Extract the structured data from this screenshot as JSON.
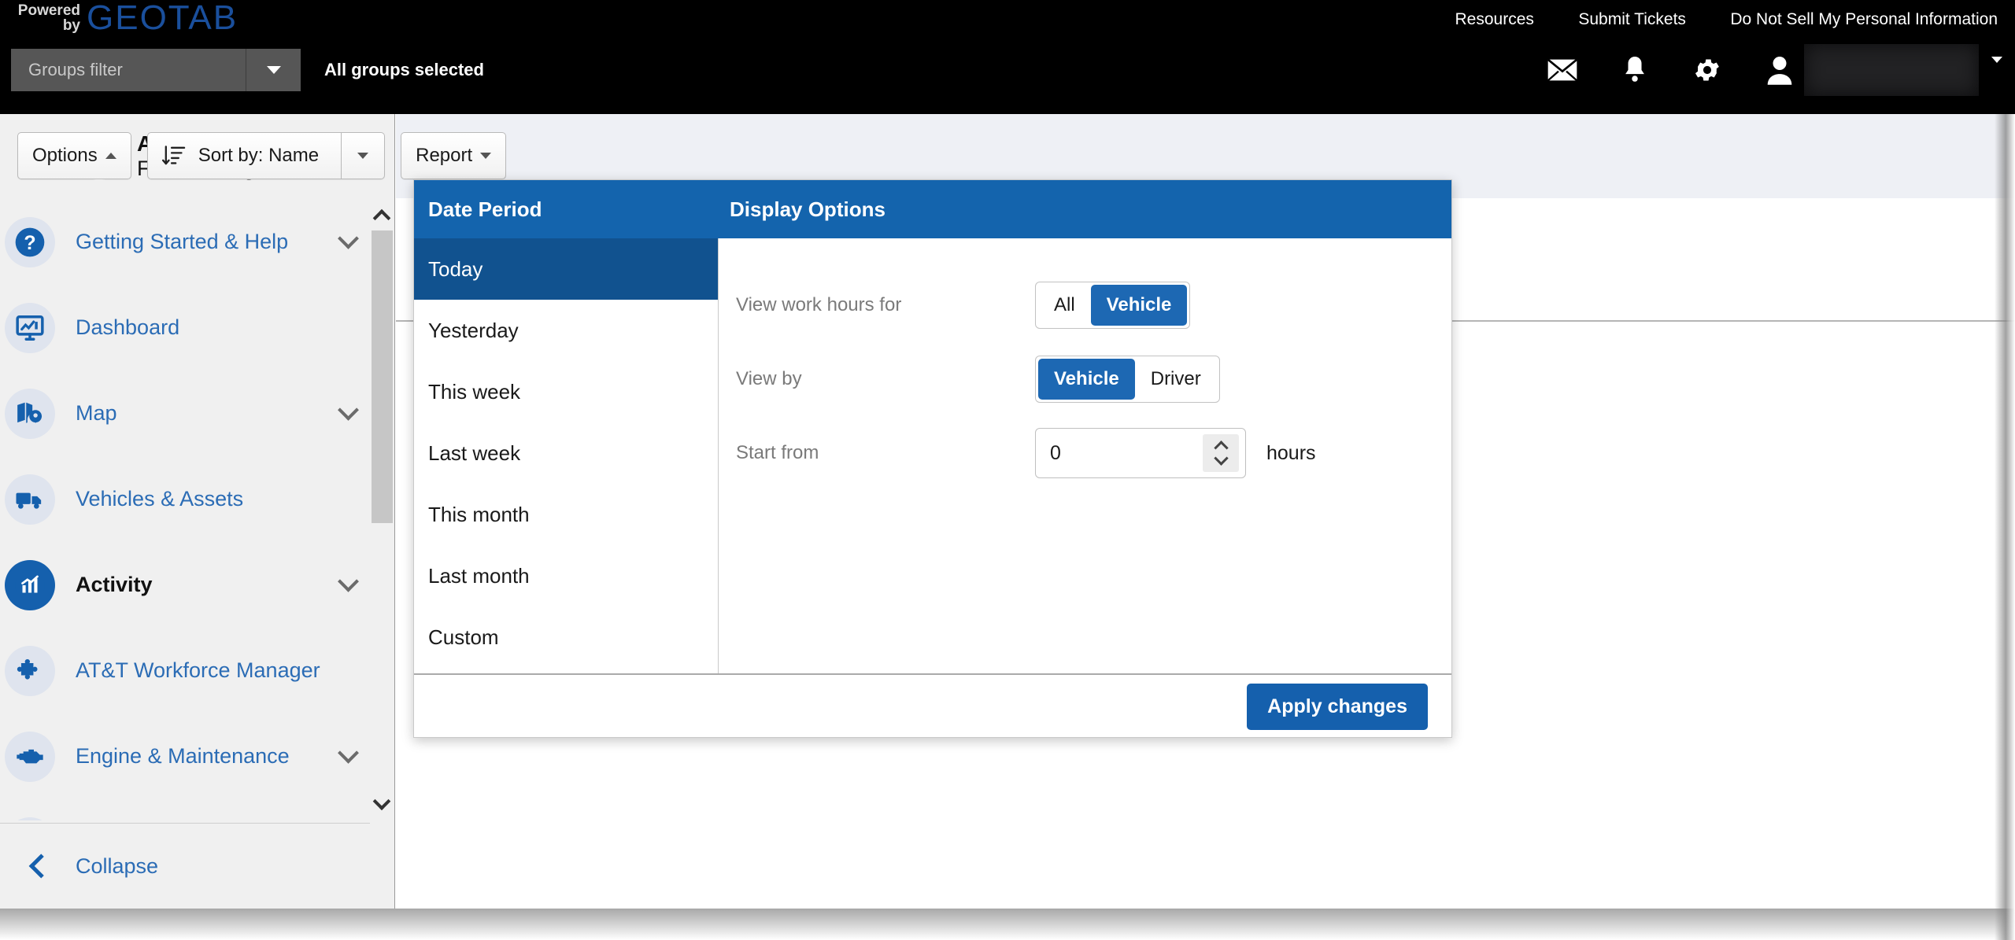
{
  "header": {
    "powered_line1": "Powered",
    "powered_line2": "by",
    "brand": "GEOTAB",
    "links": [
      {
        "label": "Resources"
      },
      {
        "label": "Submit Tickets"
      },
      {
        "label": "Do Not Sell My Personal Information"
      }
    ],
    "groups_filter_placeholder": "Groups filter",
    "groups_filter_value": "",
    "groups_selected_text": "All groups selected",
    "icons": [
      {
        "name": "mail-icon"
      },
      {
        "name": "bell-icon"
      },
      {
        "name": "gear-icon"
      },
      {
        "name": "user-icon"
      }
    ],
    "user_name": ""
  },
  "sidebar": {
    "search_icon": "search-icon",
    "product_line1": "AT&T",
    "product_line2": "Fleet Management",
    "items": [
      {
        "label": "Getting Started & Help",
        "icon": "help-circle-icon",
        "chevron": true,
        "active": false
      },
      {
        "label": "Dashboard",
        "icon": "dashboard-icon",
        "chevron": false,
        "active": false
      },
      {
        "label": "Map",
        "icon": "map-pin-icon",
        "chevron": true,
        "active": false
      },
      {
        "label": "Vehicles & Assets",
        "icon": "truck-icon",
        "chevron": false,
        "active": false
      },
      {
        "label": "Activity",
        "icon": "activity-chart-icon",
        "chevron": true,
        "active": true
      },
      {
        "label": "AT&T Workforce Manager",
        "icon": "puzzle-icon",
        "chevron": false,
        "active": false
      },
      {
        "label": "Engine & Maintenance",
        "icon": "engine-icon",
        "chevron": true,
        "active": false
      }
    ],
    "collapse_label": "Collapse"
  },
  "toolbar": {
    "options_label": "Options",
    "sort_label": "Sort by:  Name",
    "report_label": "Report"
  },
  "panel": {
    "date_period_title": "Date Period",
    "display_options_title": "Display Options",
    "date_periods": [
      {
        "label": "Today",
        "selected": true
      },
      {
        "label": "Yesterday",
        "selected": false
      },
      {
        "label": "This week",
        "selected": false
      },
      {
        "label": "Last week",
        "selected": false
      },
      {
        "label": "This month",
        "selected": false
      },
      {
        "label": "Last month",
        "selected": false
      },
      {
        "label": "Custom",
        "selected": false
      }
    ],
    "view_work_hours_for": {
      "label": "View work hours for",
      "options": [
        {
          "label": "All",
          "selected": false
        },
        {
          "label": "Vehicle",
          "selected": true
        }
      ]
    },
    "view_by": {
      "label": "View by",
      "options": [
        {
          "label": "Vehicle",
          "selected": true
        },
        {
          "label": "Driver",
          "selected": false
        }
      ]
    },
    "start_from": {
      "label": "Start from",
      "value": "0",
      "unit": "hours"
    },
    "apply_label": "Apply changes"
  },
  "colors": {
    "brand_blue": "#1560ad",
    "panel_header_blue": "#1464ad",
    "selected_row_blue": "#11528f",
    "att_cyan": "#41b6e6",
    "geotab_blue": "#1a4f9c"
  }
}
